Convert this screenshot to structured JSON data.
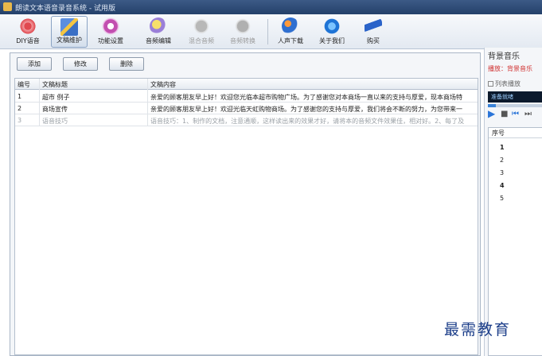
{
  "window": {
    "title": "朗读文本语音录音系统 - 试用版"
  },
  "toolbar": {
    "items": [
      {
        "label": "DIY语音"
      },
      {
        "label": "文稿维护"
      },
      {
        "label": "功能设置"
      },
      {
        "label": "音频编辑"
      },
      {
        "label": "混合音频"
      },
      {
        "label": "音频转换"
      },
      {
        "label": "人声下载"
      },
      {
        "label": "关于我们"
      },
      {
        "label": "购买"
      }
    ]
  },
  "actions": {
    "add": "添加",
    "edit": "修改",
    "delete": "删除"
  },
  "table": {
    "columns": [
      "编号",
      "文稿标题",
      "文稿内容"
    ],
    "rows": [
      {
        "id": "1",
        "title": "超市 例子",
        "content": "亲爱的顾客朋友早上好！欢迎您光临本超市购物广场。为了感谢您对本商场一直以来的支持与厚爱，现本商场特"
      },
      {
        "id": "2",
        "title": "商场宣传",
        "content": "亲爱的顾客朋友早上好！欢迎光临天虹购物商场。为了感谢您的支持与厚爱，我们将会不断的努力，为您带来一"
      },
      {
        "id": "3",
        "title": "语音技巧",
        "content": "语音技巧：1、制作的文档，注意通顺，这样读出来的效果才好，请将本的音频文件效果佳，相对好。2、每了及"
      }
    ]
  },
  "side": {
    "heading": "背景音乐",
    "hint": "播放：背景音乐",
    "checkbox": "列表播放",
    "player_text": "准备就绪",
    "list_header": "序号",
    "list_items": [
      "1",
      "2",
      "3",
      "4",
      "5"
    ]
  },
  "watermark": "最需教育"
}
